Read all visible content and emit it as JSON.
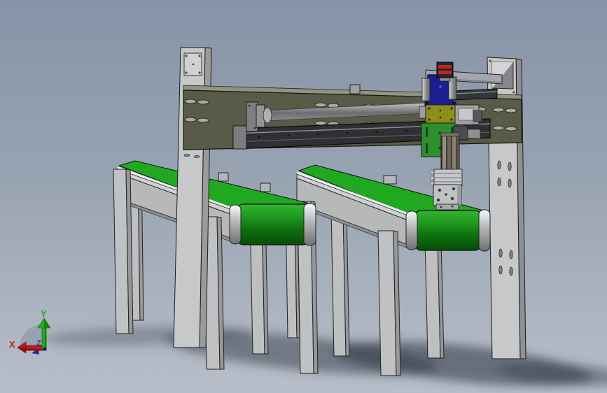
{
  "viewport": {
    "background_top": "#8893a8",
    "background_middle": "#98a3b2",
    "background_bottom": "#b8bec9"
  },
  "machine": {
    "belt_green": "#21a821",
    "drum_green_dark": "#0b570b",
    "structure_gray": "#c4c6c8",
    "structure_shade": "#9a9c9e",
    "beam_olive": "#575b47",
    "rail_dark": "#2e3033",
    "shaft_steel": "#909294",
    "actuator_blue": "#1b1e8e",
    "plate_yellow": "#8e8e1e",
    "plate_green": "#2f8f2f",
    "sensor_red": "#c32222",
    "shadow_color": "#39404e"
  },
  "triad": {
    "x_label": "X",
    "y_label": "Y",
    "z_label": "Z",
    "x_color": "#c01a1a",
    "y_color": "#1fae1f",
    "z_color": "#3434bb"
  }
}
